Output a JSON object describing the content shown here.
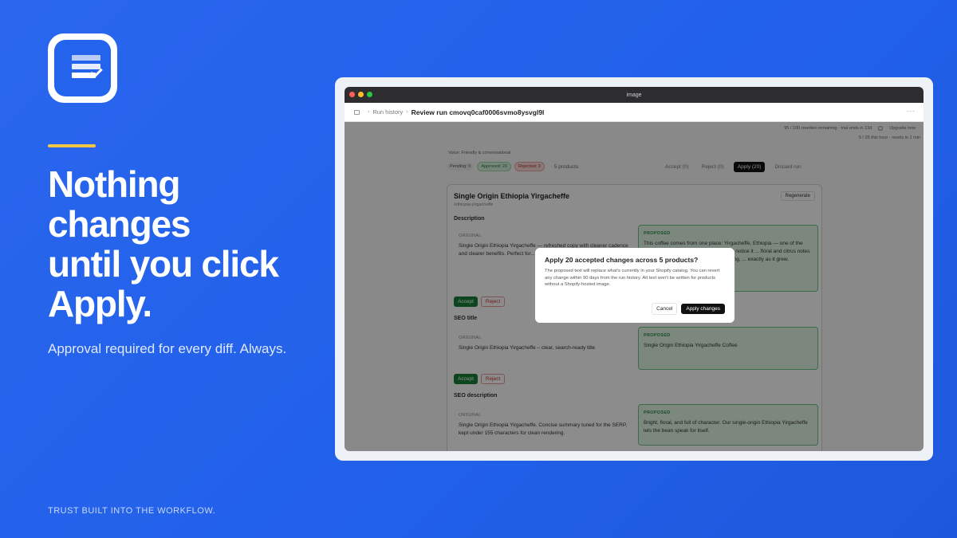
{
  "hero": {
    "headline_lines": [
      "Nothing",
      "changes",
      "until you click",
      "Apply."
    ],
    "subhead": "Approval required for every diff. Always.",
    "footer": "TRUST BUILT INTO THE WORKFLOW."
  },
  "window": {
    "title": "image",
    "breadcrumb_parent": "Run history",
    "breadcrumb_current": "Review run cmovq0caf0006svmo8ysvgl9l",
    "more_label": "···"
  },
  "usage": {
    "rewrites": "95 / 100 rewrites remaining · trial ends in 13d",
    "upgrade": "Upgrade now",
    "hourly": "5 / 25 this hour · resets in 1 min"
  },
  "voice": "Voice:  Friendly & conversational",
  "status": {
    "pending": "Pending: 0",
    "approved": "Approved: 20",
    "rejected": "Rejected: 0",
    "separator": "·",
    "products": "5 products",
    "accept": "Accept (0)",
    "reject": "Reject (0)",
    "apply": "Apply (20)",
    "discard": "Discard run"
  },
  "product": {
    "title": "Single Origin Ethiopia Yirgacheffe",
    "handle": "/ethiopia-yirgacheffe",
    "regenerate": "Regenerate",
    "original_label": "ORIGINAL",
    "proposed_label": "PROPOSED",
    "accept_label": "Accept",
    "reject_label": "Reject",
    "fields": [
      {
        "label": "Description",
        "original": "Single Origin Ethiopia Yirgacheffe — refreshed copy with cleaner cadence and clearer benefits. Perfect for... Ready to ship",
        "proposed": "This coffee comes from one place: Yirgacheffe, Ethiopia — one of the oldest coffee regions in the world. You'll notice it ... floral and citrus notes that ... coffees are known for. No blending, ... exactly as it grew."
      },
      {
        "label": "SEO title",
        "original": "Single Origin Ethiopia Yirgacheffe – clear, search-ready title",
        "proposed": "Single Origin Ethiopia Yirgacheffe Coffee"
      },
      {
        "label": "SEO description",
        "original": "Single Origin Ethiopia Yirgacheffe. Concise summary tuned for the SERP, kept under 155 characters for clean rendering.",
        "proposed": "Bright, floral, and full of character. Our single-origin Ethiopia Yirgacheffe lets the bean speak for itself."
      }
    ]
  },
  "modal": {
    "title": "Apply 20 accepted changes across 5 products?",
    "body": "The proposed text will replace what's currently in your Shopify catalog. You can revert any change within 90 days from the run history. Alt text won't be written for products without a Shopify-hosted image.",
    "cancel": "Cancel",
    "apply": "Apply changes"
  },
  "colors": {
    "background": "#2463eb",
    "accent_line": "#f6c646",
    "approved_green": "#198038",
    "rejected_red": "#cc3333"
  }
}
